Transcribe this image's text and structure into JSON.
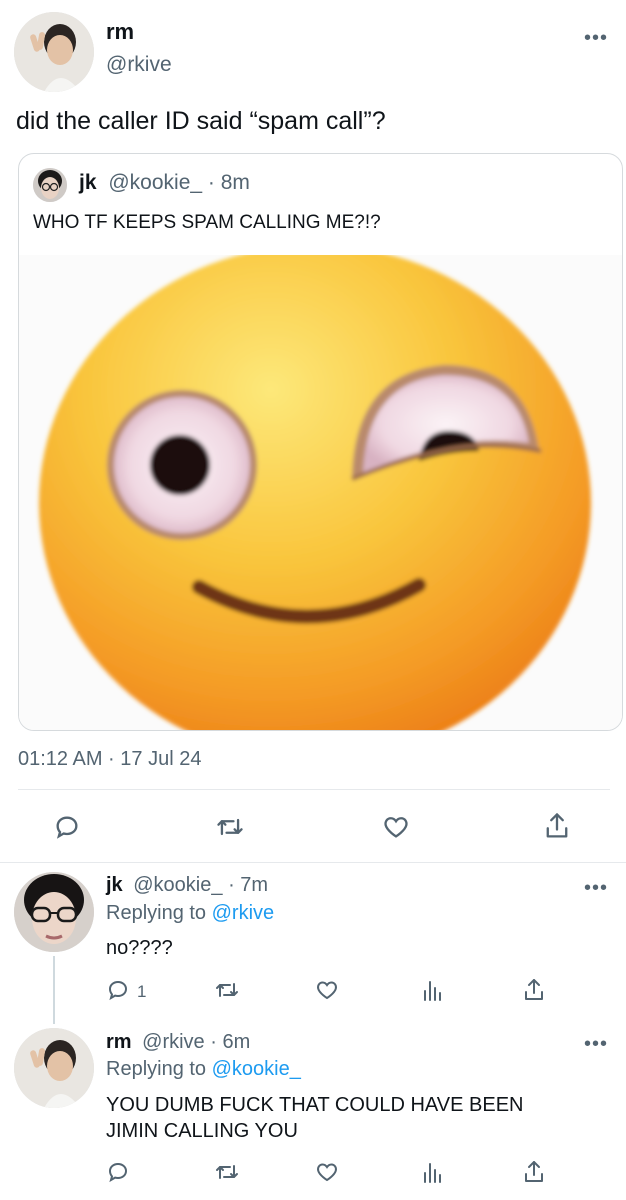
{
  "main_tweet": {
    "name": "rm",
    "handle": "@rkive",
    "text": "did the caller ID said “spam call”?",
    "timestamp": "01:12 AM · 17 Jul 24"
  },
  "quoted_tweet": {
    "name": "jk",
    "handle": "@kookie_",
    "time": "· 8m",
    "text": "WHO TF KEEPS SPAM CALLING ME?!?"
  },
  "replies": [
    {
      "name": "jk",
      "handle": "@kookie_",
      "time": "· 7m",
      "replying_prefix": "Replying to",
      "replying_to": "@rkive",
      "text": "no????",
      "reply_count": "1"
    },
    {
      "name": "rm",
      "handle": "@rkive",
      "time": "· 6m",
      "replying_prefix": "Replying to",
      "replying_to": "@kookie_",
      "text_line1": "YOU DUMB FUCK THAT COULD HAVE BEEN",
      "text_line2": "JIMIN CALLING YOU"
    }
  ],
  "colors": {
    "text": "#0f1419",
    "muted": "#536471",
    "link": "#1d9bf0",
    "divider": "#e6e9ec"
  },
  "icons": [
    "more-icon",
    "reply-icon",
    "retweet-icon",
    "like-icon",
    "share-icon",
    "analytics-icon"
  ]
}
